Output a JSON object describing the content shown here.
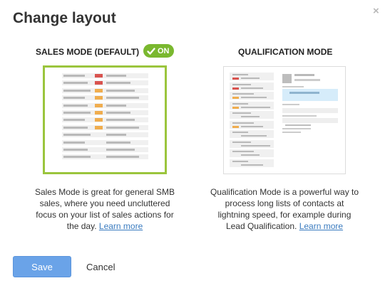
{
  "dialog": {
    "title": "Change layout",
    "close_glyph": "×"
  },
  "sales_mode": {
    "heading": "SALES MODE (DEFAULT)",
    "badge_label": "ON",
    "badge_icon": "check-icon",
    "description": "Sales Mode is great for general SMB sales, where you need uncluttered focus on your list of sales actions for the day.",
    "learn_more": "Learn more"
  },
  "qualification_mode": {
    "heading": "QUALIFICATION MODE",
    "description": "Qualification Mode is a powerful way to process long lists of contacts at lightning speed, for example during Lead Qualification.",
    "learn_more": "Learn more"
  },
  "footer": {
    "save_label": "Save",
    "cancel_label": "Cancel"
  },
  "colors": {
    "accent_green": "#7ab82f",
    "preview_border_active": "#9bc53d",
    "save_blue": "#6aa3e8",
    "link_blue": "#3a7bbf",
    "mark_red": "#d9534f",
    "mark_orange": "#f0ad4e",
    "highlight_blue": "#d6ecfa"
  }
}
